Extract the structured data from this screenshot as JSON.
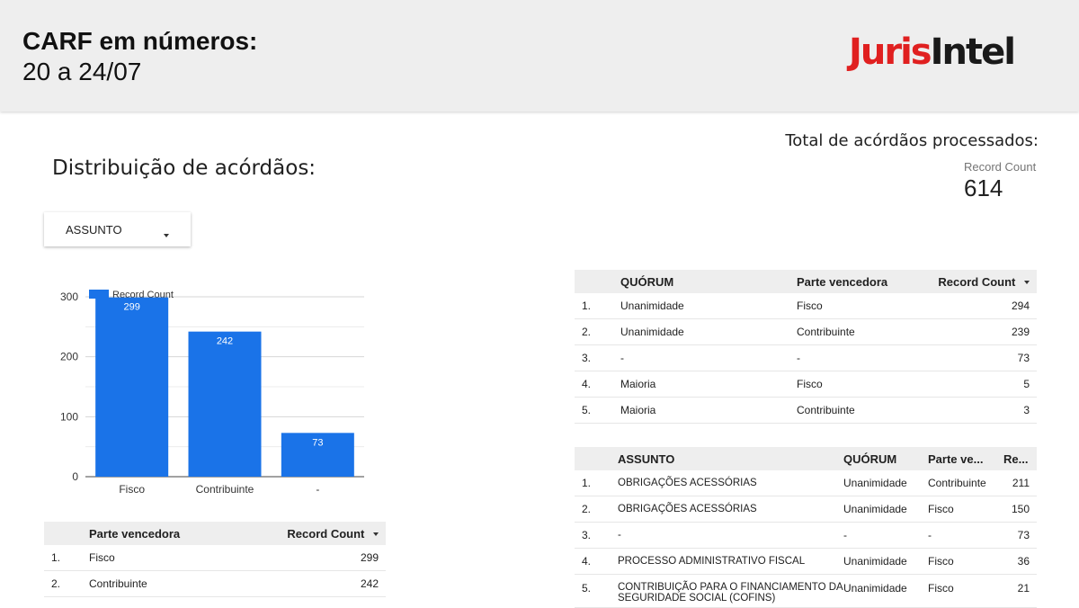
{
  "header": {
    "title": "CARF em números:",
    "subtitle": "20 a 24/07",
    "logo_part1": "Juris",
    "logo_part2": "Intel"
  },
  "section_title": "Distribuição de acórdãos:",
  "total": {
    "title": "Total de acórdãos processados:",
    "label": "Record Count",
    "value": "614"
  },
  "dropdown": {
    "label": "ASSUNTO"
  },
  "colors": {
    "bar": "#1a73e8",
    "header_bg": "#eeeeee",
    "logo_red": "#e02020"
  },
  "chart_data": {
    "type": "bar",
    "categories": [
      "Fisco",
      "Contribuinte",
      "-"
    ],
    "series": [
      {
        "name": "Record Count",
        "values": [
          299,
          242,
          73
        ]
      }
    ],
    "yticks": [
      0,
      100,
      200,
      300
    ],
    "ylim": [
      0,
      330
    ],
    "legend": "top-left"
  },
  "table_parte": {
    "columns": [
      "Parte vencedora",
      "Record Count"
    ],
    "rows": [
      {
        "idx": "1.",
        "parte": "Fisco",
        "count": "299"
      },
      {
        "idx": "2.",
        "parte": "Contribuinte",
        "count": "242"
      }
    ]
  },
  "table_quorum": {
    "columns": [
      "QUÓRUM",
      "Parte vencedora",
      "Record Count"
    ],
    "rows": [
      {
        "idx": "1.",
        "quorum": "Unanimidade",
        "parte": "Fisco",
        "count": "294"
      },
      {
        "idx": "2.",
        "quorum": "Unanimidade",
        "parte": "Contribuinte",
        "count": "239"
      },
      {
        "idx": "3.",
        "quorum": "-",
        "parte": "-",
        "count": "73"
      },
      {
        "idx": "4.",
        "quorum": "Maioria",
        "parte": "Fisco",
        "count": "5"
      },
      {
        "idx": "5.",
        "quorum": "Maioria",
        "parte": "Contribuinte",
        "count": "3"
      }
    ]
  },
  "table_assunto": {
    "columns": [
      "ASSUNTO",
      "QUÓRUM",
      "Parte ve...",
      "Re..."
    ],
    "rows": [
      {
        "idx": "1.",
        "assunto": "OBRIGAÇÕES ACESSÓRIAS",
        "quorum": "Unanimidade",
        "parte": "Contribuinte",
        "count": "211"
      },
      {
        "idx": "2.",
        "assunto": "OBRIGAÇÕES ACESSÓRIAS",
        "quorum": "Unanimidade",
        "parte": "Fisco",
        "count": "150"
      },
      {
        "idx": "3.",
        "assunto": "-",
        "quorum": "-",
        "parte": "-",
        "count": "73"
      },
      {
        "idx": "4.",
        "assunto": "PROCESSO ADMINISTRATIVO FISCAL",
        "quorum": "Unanimidade",
        "parte": "Fisco",
        "count": "36"
      },
      {
        "idx": "5.",
        "assunto": "CONTRIBUIÇÃO PARA O FINANCIAMENTO DA SEGURIDADE SOCIAL (COFINS)",
        "quorum": "Unanimidade",
        "parte": "Fisco",
        "count": "21"
      }
    ]
  }
}
